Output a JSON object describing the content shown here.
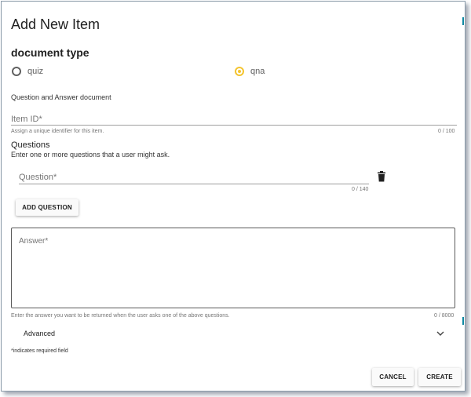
{
  "dialog": {
    "title": "Add New Item"
  },
  "document_type": {
    "heading": "document type",
    "options": [
      {
        "label": "quiz",
        "selected": false
      },
      {
        "label": "qna",
        "selected": true
      }
    ],
    "description": "Question and Answer document"
  },
  "item_id": {
    "label": "Item ID*",
    "hint": "Assign a unique identifier for this item.",
    "counter": "0 / 100"
  },
  "questions": {
    "heading": "Questions",
    "subheading": "Enter one or more questions that a user might ask.",
    "question_label": "Question*",
    "question_counter": "0 / 140",
    "add_button": "ADD QUESTION",
    "delete_icon": "trash-icon"
  },
  "answer": {
    "label": "Answer*",
    "hint": "Enter the answer you want to be returned when the user asks one of the above questions.",
    "counter": "0 / 8000"
  },
  "advanced": {
    "label": "Advanced",
    "icon": "chevron-down-icon"
  },
  "footer": {
    "required_note": "*indicates required field",
    "cancel_label": "CANCEL",
    "create_label": "CREATE"
  },
  "colors": {
    "accent": "#f4c430",
    "edge": "#0f8aa3",
    "border": "#8a9aa8"
  }
}
